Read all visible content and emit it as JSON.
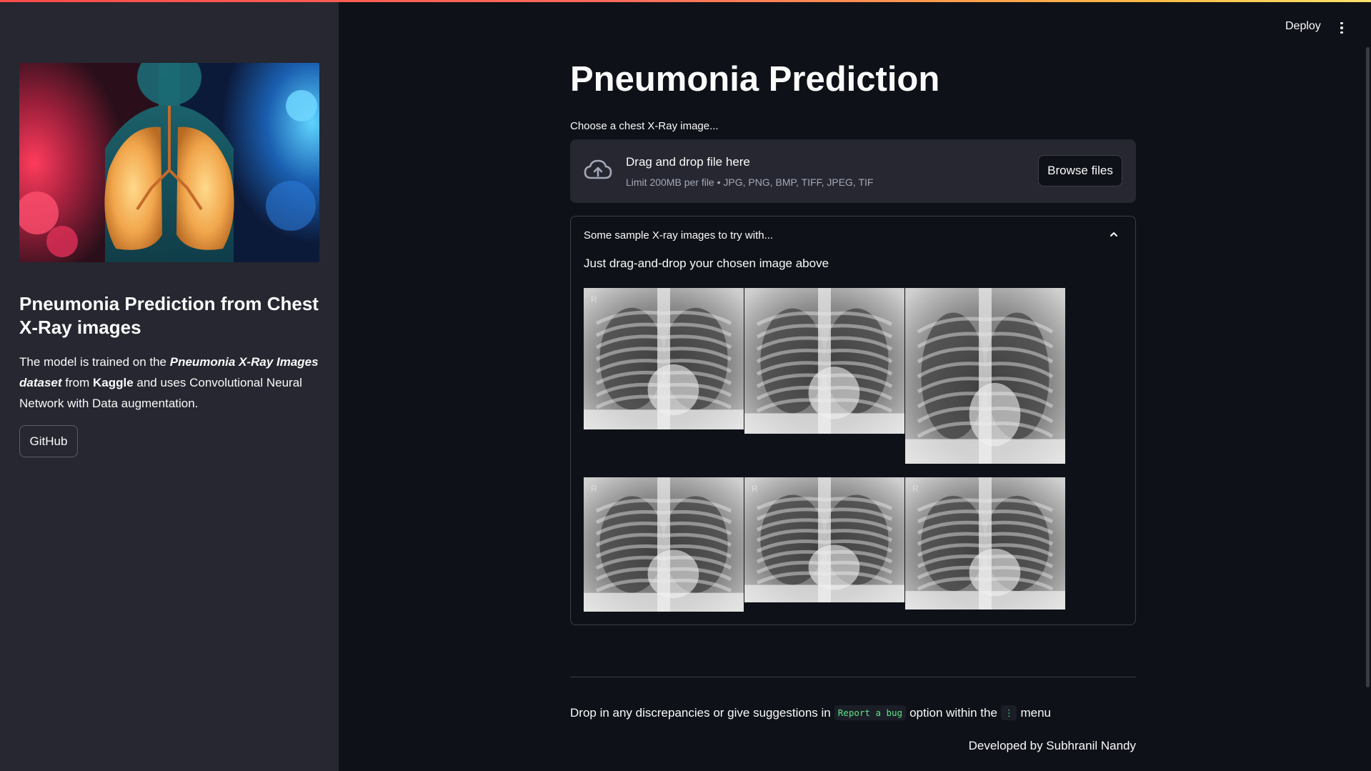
{
  "header": {
    "deploy_label": "Deploy",
    "menu_icon": "kebab-menu-icon"
  },
  "sidebar": {
    "hero_image": "lungs-illustration",
    "title": "Pneumonia Prediction from Chest X-Ray images",
    "description": {
      "part1": "The model is trained on the ",
      "dataset_name": "Pneumonia X-Ray Images dataset",
      "part2": " from ",
      "source": "Kaggle",
      "part3": " and uses Convolutional Neural Network with Data augmentation."
    },
    "github_label": "GitHub"
  },
  "main": {
    "title": "Pneumonia Prediction",
    "uploader": {
      "label": "Choose a chest X-Ray image...",
      "drop_title": "Drag and drop file here",
      "drop_subtitle": "Limit 200MB per file • JPG, PNG, BMP, TIFF, JPEG, TIF",
      "browse_label": "Browse files",
      "icon": "cloud-upload-icon"
    },
    "expander": {
      "header": "Some sample X-ray images to try with...",
      "text": "Just drag-and-drop your chosen image above",
      "images": [
        {
          "name": "sample-xray-1",
          "marker": "R"
        },
        {
          "name": "sample-xray-2",
          "marker": ""
        },
        {
          "name": "sample-xray-3",
          "marker": ""
        },
        {
          "name": "sample-xray-4",
          "marker": "R"
        },
        {
          "name": "sample-xray-5",
          "marker": "R"
        },
        {
          "name": "sample-xray-6",
          "marker": "R"
        }
      ]
    },
    "footer": {
      "prefix": "Drop in any discrepancies or give suggestions in",
      "code1": "Report a bug",
      "middle": "option within the",
      "code2": "⋮",
      "suffix": "menu",
      "developed_by": "Developed by Subhranil Nandy"
    }
  }
}
